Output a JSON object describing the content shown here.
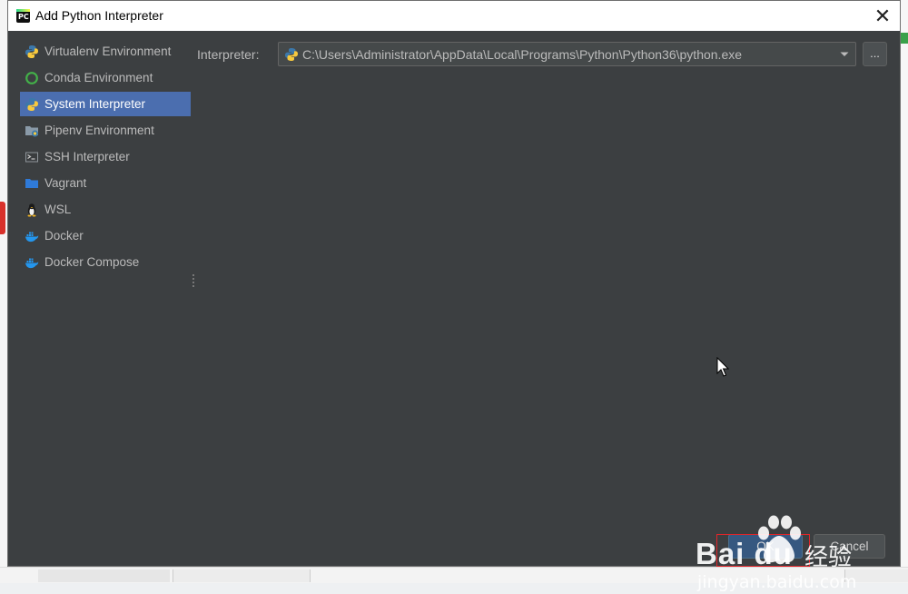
{
  "dialog": {
    "title": "Add Python Interpreter",
    "close_glyph": "✕"
  },
  "sidebar": {
    "items": [
      {
        "label": "Virtualenv Environment",
        "icon": "python-icon"
      },
      {
        "label": "Conda Environment",
        "icon": "conda-ring-icon"
      },
      {
        "label": "System Interpreter",
        "icon": "python-icon",
        "selected": true
      },
      {
        "label": "Pipenv Environment",
        "icon": "pipenv-folder-icon"
      },
      {
        "label": "SSH Interpreter",
        "icon": "terminal-icon"
      },
      {
        "label": "Vagrant",
        "icon": "vagrant-folder-icon"
      },
      {
        "label": "WSL",
        "icon": "linux-penguin-icon"
      },
      {
        "label": "Docker",
        "icon": "docker-icon"
      },
      {
        "label": "Docker Compose",
        "icon": "docker-icon"
      }
    ]
  },
  "interpreter": {
    "label": "Interpreter:",
    "value": "C:\\Users\\Administrator\\AppData\\Local\\Programs\\Python\\Python36\\python.exe",
    "browse_label": "..."
  },
  "buttons": {
    "ok_label": "OK",
    "cancel_label": "Cancel"
  },
  "watermark": {
    "brand": "Bai  du",
    "cn": "经验",
    "url": "jingyan.baidu.com"
  },
  "colors": {
    "dialog_bg": "#3c3f41",
    "selection": "#4b6eaf",
    "ok_button": "#365880",
    "highlight": "#e0262a"
  }
}
